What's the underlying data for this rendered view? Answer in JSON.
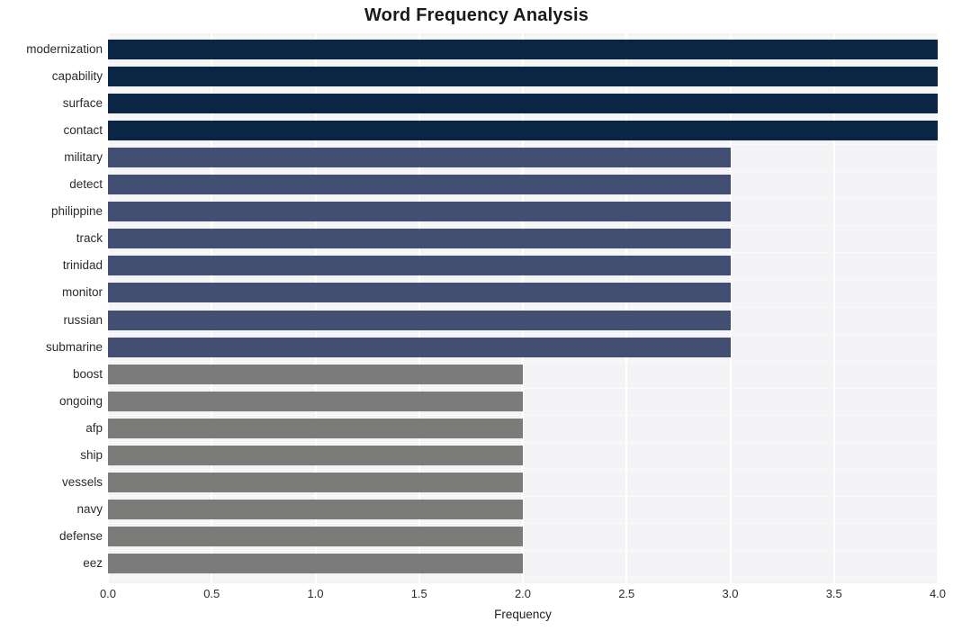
{
  "chart_data": {
    "type": "bar",
    "orientation": "horizontal",
    "title": "Word Frequency Analysis",
    "xlabel": "Frequency",
    "ylabel": "",
    "xlim": [
      0.0,
      4.0
    ],
    "xticks": [
      "0.0",
      "0.5",
      "1.0",
      "1.5",
      "2.0",
      "2.5",
      "3.0",
      "3.5",
      "4.0"
    ],
    "xtick_values": [
      0.0,
      0.5,
      1.0,
      1.5,
      2.0,
      2.5,
      3.0,
      3.5,
      4.0
    ],
    "grid": true,
    "grid_color": "#ffffff",
    "plot_background": "#f4f4f6",
    "figure_background": "#ffffff",
    "legend": "none",
    "categories": [
      "modernization",
      "capability",
      "surface",
      "contact",
      "military",
      "detect",
      "philippine",
      "track",
      "trinidad",
      "monitor",
      "russian",
      "submarine",
      "boost",
      "ongoing",
      "afp",
      "ship",
      "vessels",
      "navy",
      "defense",
      "eez"
    ],
    "values": [
      4,
      4,
      4,
      4,
      3,
      3,
      3,
      3,
      3,
      3,
      3,
      3,
      2,
      2,
      2,
      2,
      2,
      2,
      2,
      2
    ],
    "bar_colors": [
      "#0b2545",
      "#0b2545",
      "#0b2545",
      "#0b2545",
      "#434f72",
      "#434f72",
      "#434f72",
      "#434f72",
      "#434f72",
      "#434f72",
      "#434f72",
      "#434f72",
      "#7b7b79",
      "#7b7b79",
      "#7b7b79",
      "#7b7b79",
      "#7b7b79",
      "#7b7b79",
      "#7b7b79",
      "#7b7b79"
    ],
    "color_tiers": {
      "high": "#0b2545",
      "medium": "#434f72",
      "low": "#7b7b79"
    }
  }
}
